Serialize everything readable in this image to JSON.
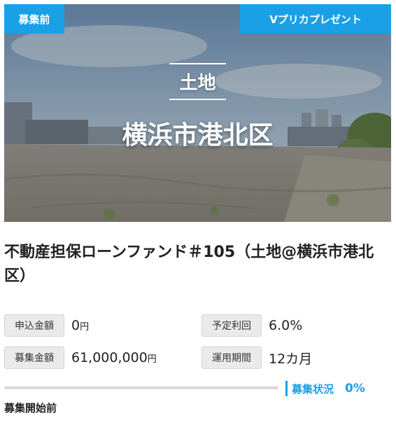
{
  "hero": {
    "status_badge": "募集前",
    "promo_badge": "Vプリカプレゼント",
    "category": "土地",
    "location": "横浜市港北区"
  },
  "fund": {
    "title": "不動産担保ローンファンド＃105（土地@横浜市港北区）"
  },
  "details": {
    "applied_label": "申込金額",
    "applied_value": "0",
    "applied_unit": "円",
    "yield_label": "予定利回",
    "yield_value": "6.0%",
    "target_label": "募集金額",
    "target_value": "61,000,000",
    "target_unit": "円",
    "period_label": "運用期間",
    "period_value": "12カ月"
  },
  "progress": {
    "label": "募集状況",
    "percent_text": "0%",
    "fraction": 0
  },
  "start_status": "募集開始前",
  "colors": {
    "accent": "#1aa0e6"
  }
}
